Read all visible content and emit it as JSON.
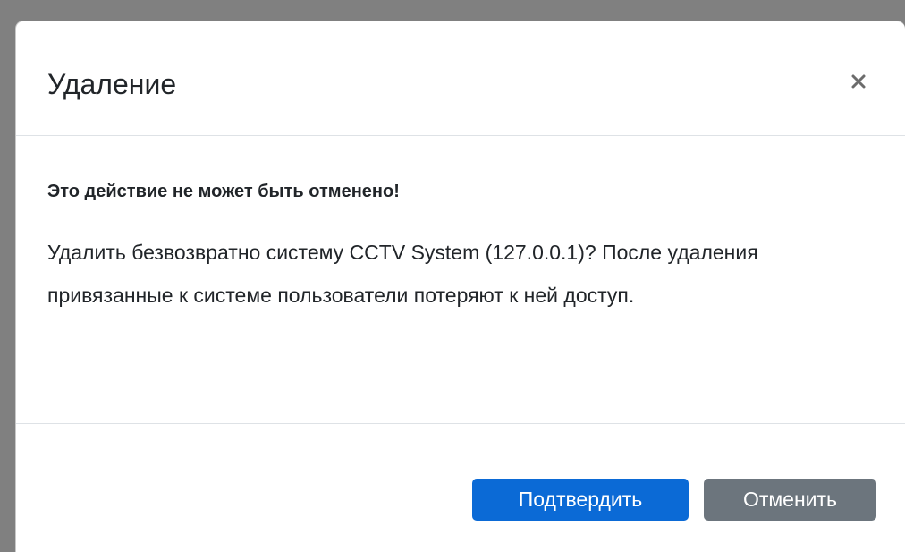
{
  "modal": {
    "title": "Удаление",
    "close_icon": "close-icon",
    "warning": "Это действие не может быть отменено!",
    "description": "Удалить безвозвратно систему CCTV System (127.0.0.1)? После удаления привязанные к системе пользователи потеряют к ней доступ.",
    "confirm_label": "Подтвердить",
    "cancel_label": "Отменить"
  },
  "colors": {
    "backdrop": "#808080",
    "primary": "#0b6ad6",
    "secondary": "#6c757d",
    "text": "#212529"
  }
}
